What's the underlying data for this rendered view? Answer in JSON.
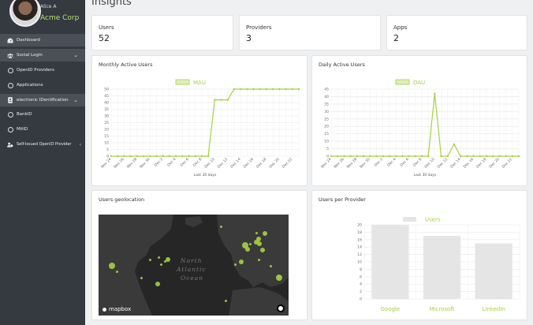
{
  "sidebar": {
    "user_name": "Alice A",
    "company": "Acme Corp",
    "items": [
      {
        "label": "Dashboard",
        "icon": "dashboard-icon"
      },
      {
        "label": "Social Login",
        "icon": "users-icon"
      },
      {
        "label": "OpenID Providers",
        "icon": "circle-icon"
      },
      {
        "label": "Applications",
        "icon": "circle-icon"
      },
      {
        "label": "electronic IDentification",
        "icon": "id-card-icon"
      },
      {
        "label": "BankID",
        "icon": "circle-icon"
      },
      {
        "label": "MitID",
        "icon": "circle-icon"
      },
      {
        "label": "Self-Issued OpenID Provider",
        "icon": "user-shield-icon"
      }
    ]
  },
  "page": {
    "title": "Insights"
  },
  "stats": [
    {
      "label": "Users",
      "value": "52"
    },
    {
      "label": "Providers",
      "value": "3"
    },
    {
      "label": "Apps",
      "value": "2"
    }
  ],
  "colors": {
    "accent": "#a6d144",
    "sidebar": "#343a40",
    "bar": "#e5e5e5"
  },
  "charts": {
    "mau": {
      "title": "Monthly Active Users"
    },
    "dau": {
      "title": "Daily Active Users"
    },
    "geo": {
      "title": "Users geolocation",
      "ocean_line1": "North",
      "ocean_line2": "Atlantic",
      "ocean_line3": "Ocean",
      "mapbox": "mapbox"
    },
    "providers": {
      "title": "Users per Provider"
    }
  },
  "chart_data": [
    {
      "type": "line",
      "legend": "MAU",
      "xlabel": "Last 30 days",
      "ylim": [
        0,
        50
      ],
      "yticks": [
        0,
        5,
        10,
        15,
        20,
        25,
        30,
        35,
        40,
        45,
        50
      ],
      "x": [
        "Nov 24",
        "Nov 25",
        "Nov 26",
        "Nov 27",
        "Nov 28",
        "Nov 29",
        "Nov 30",
        "Dec 1",
        "Dec 2",
        "Dec 3",
        "Dec 4",
        "Dec 5",
        "Dec 6",
        "Dec 7",
        "Dec 8",
        "Dec 9",
        "Dec 10",
        "Dec 11",
        "Dec 12",
        "Dec 13",
        "Dec 14",
        "Dec 15",
        "Dec 16",
        "Dec 17",
        "Dec 18",
        "Dec 19",
        "Dec 20",
        "Dec 21",
        "Dec 22",
        "Dec 23"
      ],
      "xtick_labels": [
        "Nov 24",
        "Nov 26",
        "Nov 28",
        "Nov 30",
        "Dec 2",
        "Dec 4",
        "Dec 6",
        "Dec 8",
        "Dec 10",
        "Dec 12",
        "Dec 14",
        "Dec 16",
        "Dec 18",
        "Dec 20",
        "Dec 22"
      ],
      "values": [
        0,
        0,
        0,
        0,
        0,
        0,
        0,
        0,
        0,
        0,
        0,
        0,
        0,
        0,
        0,
        0,
        42,
        42,
        42,
        50,
        50,
        50,
        50,
        50,
        50,
        50,
        50,
        50,
        50,
        50
      ]
    },
    {
      "type": "line",
      "legend": "DAU",
      "xlabel": "Last 30 days",
      "ylim": [
        0,
        45
      ],
      "yticks": [
        0,
        5,
        10,
        15,
        20,
        25,
        30,
        35,
        40,
        45
      ],
      "x": [
        "Nov 24",
        "Nov 25",
        "Nov 26",
        "Nov 27",
        "Nov 28",
        "Nov 29",
        "Nov 30",
        "Dec 1",
        "Dec 2",
        "Dec 3",
        "Dec 4",
        "Dec 5",
        "Dec 6",
        "Dec 7",
        "Dec 8",
        "Dec 9",
        "Dec 10",
        "Dec 11",
        "Dec 12",
        "Dec 13",
        "Dec 14",
        "Dec 15",
        "Dec 16",
        "Dec 17",
        "Dec 18",
        "Dec 19",
        "Dec 20",
        "Dec 21",
        "Dec 22",
        "Dec 23"
      ],
      "xtick_labels": [
        "Nov 24",
        "Nov 26",
        "Nov 28",
        "Nov 30",
        "Dec 2",
        "Dec 4",
        "Dec 6",
        "Dec 8",
        "Dec 10",
        "Dec 12",
        "Dec 14",
        "Dec 16",
        "Dec 18",
        "Dec 20",
        "Dec 22"
      ],
      "values": [
        0,
        0,
        0,
        0,
        0,
        0,
        0,
        0,
        0,
        0,
        0,
        0,
        0,
        0,
        0,
        0,
        42,
        0,
        0,
        8,
        0,
        0,
        0,
        0,
        0,
        0,
        0,
        0,
        0,
        0
      ]
    },
    {
      "type": "bar",
      "legend": "Users",
      "categories": [
        "Google",
        "Microsoft",
        "LinkedIn"
      ],
      "values": [
        20,
        17,
        15
      ],
      "ylim": [
        0,
        20
      ],
      "yticks": [
        0,
        2,
        4,
        6,
        8,
        10,
        12,
        14,
        16,
        18,
        20
      ]
    }
  ],
  "geo_points": [
    {
      "lon": -122.4,
      "lat": 37.8,
      "size": "large"
    },
    {
      "lon": -74.0,
      "lat": 40.7,
      "size": "small"
    },
    {
      "lon": -87.6,
      "lat": 41.9,
      "size": "small"
    },
    {
      "lon": -79.4,
      "lat": 43.7,
      "size": "small"
    },
    {
      "lon": -80.2,
      "lat": 25.8,
      "size": "medium"
    },
    {
      "lon": -95.4,
      "lat": 29.8,
      "size": "small"
    },
    {
      "lon": -71.1,
      "lat": 42.4,
      "size": "medium"
    },
    {
      "lon": -77.0,
      "lat": 38.9,
      "size": "small"
    },
    {
      "lon": -118.2,
      "lat": 34.1,
      "size": "small"
    },
    {
      "lon": -0.1,
      "lat": 51.5,
      "size": "large"
    },
    {
      "lon": 2.3,
      "lat": 48.9,
      "size": "medium"
    },
    {
      "lon": -3.7,
      "lat": 40.4,
      "size": "medium"
    },
    {
      "lon": 10.0,
      "lat": 53.5,
      "size": "medium"
    },
    {
      "lon": 12.6,
      "lat": 55.7,
      "size": "medium"
    },
    {
      "lon": 18.1,
      "lat": 59.3,
      "size": "medium"
    },
    {
      "lon": 10.8,
      "lat": 59.9,
      "size": "small"
    },
    {
      "lon": 4.9,
      "lat": 52.4,
      "size": "small"
    },
    {
      "lon": 13.4,
      "lat": 52.5,
      "size": "medium"
    },
    {
      "lon": 16.4,
      "lat": 48.2,
      "size": "medium"
    },
    {
      "lon": -21.9,
      "lat": 64.1,
      "size": "small"
    },
    {
      "lon": -9.1,
      "lat": 38.7,
      "size": "small"
    },
    {
      "lon": 12.5,
      "lat": 41.9,
      "size": "small"
    },
    {
      "lon": 23.7,
      "lat": 37.9,
      "size": "small"
    },
    {
      "lon": 31.2,
      "lat": 30.0,
      "size": "large"
    },
    {
      "lon": -17.4,
      "lat": 14.7,
      "size": "small"
    }
  ]
}
